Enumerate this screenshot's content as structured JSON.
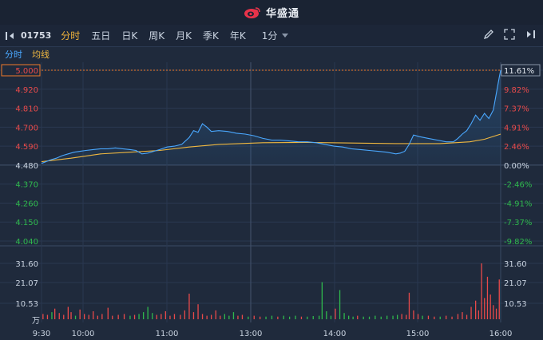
{
  "app": {
    "brand": "华盛通"
  },
  "toolbar": {
    "stock_code": "01753",
    "tabs": [
      "分时",
      "五日",
      "日K",
      "周K",
      "月K",
      "季K",
      "年K"
    ],
    "active_tab": "分时",
    "period": "1分"
  },
  "legend": {
    "price_label": "分时",
    "avg_label": "均线"
  },
  "icons": {
    "brand": "weibo-eye-icon",
    "collapse": "collapse-sidebar-icon",
    "draw": "pencil-icon",
    "fullscreen": "fullscreen-icon",
    "expand": "expand-panel-icon",
    "dropdown": "triangle-down-icon"
  },
  "colors": {
    "up": "#e84a4a",
    "down": "#2fb84d",
    "price_line": "#4aa8ff",
    "avg_line": "#f0b840",
    "current_price": "#f07a2a"
  },
  "chart_data": {
    "type": "line",
    "prev_close": 4.48,
    "current_price": "5.000",
    "current_change": "11.61%",
    "price_ticks": [
      "5.000",
      "4.920",
      "4.810",
      "4.700",
      "4.590",
      "4.480",
      "4.370",
      "4.260",
      "4.150",
      "4.040"
    ],
    "pct_ticks": [
      "11.61%",
      "9.82%",
      "7.37%",
      "4.91%",
      "2.46%",
      "0.00%",
      "-2.46%",
      "-4.91%",
      "-7.37%",
      "-9.82%"
    ],
    "ylim": [
      4.0,
      5.0
    ],
    "volume_ticks": [
      "31.60",
      "21.07",
      "10.53"
    ],
    "volume_unit": "万",
    "volume_max": 31.6,
    "x_ticks": [
      "9:30",
      "10:00",
      "11:00",
      "13:00",
      "14:00",
      "15:00",
      "16:00"
    ],
    "series": [
      {
        "name": "分时",
        "points": [
          [
            0,
            4.49
          ],
          [
            3,
            4.5
          ],
          [
            6,
            4.51
          ],
          [
            10,
            4.52
          ],
          [
            14,
            4.535
          ],
          [
            18,
            4.545
          ],
          [
            22,
            4.555
          ],
          [
            26,
            4.56
          ],
          [
            30,
            4.565
          ],
          [
            35,
            4.57
          ],
          [
            40,
            4.575
          ],
          [
            45,
            4.575
          ],
          [
            50,
            4.58
          ],
          [
            55,
            4.575
          ],
          [
            60,
            4.57
          ],
          [
            64,
            4.565
          ],
          [
            68,
            4.545
          ],
          [
            72,
            4.55
          ],
          [
            76,
            4.56
          ],
          [
            80,
            4.57
          ],
          [
            85,
            4.585
          ],
          [
            90,
            4.59
          ],
          [
            95,
            4.6
          ],
          [
            100,
            4.64
          ],
          [
            103,
            4.68
          ],
          [
            106,
            4.67
          ],
          [
            109,
            4.72
          ],
          [
            112,
            4.7
          ],
          [
            115,
            4.675
          ],
          [
            120,
            4.68
          ],
          [
            126,
            4.675
          ],
          [
            132,
            4.665
          ],
          [
            138,
            4.66
          ],
          [
            144,
            4.65
          ],
          [
            150,
            4.635
          ],
          [
            156,
            4.625
          ],
          [
            162,
            4.625
          ],
          [
            168,
            4.62
          ],
          [
            174,
            4.615
          ],
          [
            180,
            4.615
          ],
          [
            186,
            4.61
          ],
          [
            192,
            4.6
          ],
          [
            198,
            4.59
          ],
          [
            204,
            4.585
          ],
          [
            210,
            4.575
          ],
          [
            216,
            4.57
          ],
          [
            222,
            4.565
          ],
          [
            228,
            4.56
          ],
          [
            234,
            4.555
          ],
          [
            240,
            4.545
          ],
          [
            243,
            4.55
          ],
          [
            246,
            4.56
          ],
          [
            249,
            4.6
          ],
          [
            252,
            4.655
          ],
          [
            256,
            4.645
          ],
          [
            262,
            4.635
          ],
          [
            268,
            4.625
          ],
          [
            274,
            4.615
          ],
          [
            279,
            4.615
          ],
          [
            282,
            4.635
          ],
          [
            285,
            4.66
          ],
          [
            288,
            4.68
          ],
          [
            291,
            4.72
          ],
          [
            294,
            4.77
          ],
          [
            297,
            4.74
          ],
          [
            300,
            4.78
          ],
          [
            303,
            4.75
          ],
          [
            306,
            4.8
          ],
          [
            310,
            4.97
          ],
          [
            311,
            5.0
          ]
        ]
      },
      {
        "name": "均线",
        "points": [
          [
            0,
            4.5
          ],
          [
            20,
            4.52
          ],
          [
            40,
            4.545
          ],
          [
            60,
            4.555
          ],
          [
            80,
            4.565
          ],
          [
            100,
            4.585
          ],
          [
            120,
            4.6
          ],
          [
            150,
            4.61
          ],
          [
            180,
            4.612
          ],
          [
            210,
            4.608
          ],
          [
            240,
            4.605
          ],
          [
            270,
            4.605
          ],
          [
            290,
            4.615
          ],
          [
            300,
            4.63
          ],
          [
            311,
            4.66
          ]
        ]
      }
    ],
    "volume_bars": [
      [
        1,
        3.0,
        "up"
      ],
      [
        4,
        2.5,
        "up"
      ],
      [
        7,
        4.0,
        "down"
      ],
      [
        9,
        6.0,
        "up"
      ],
      [
        12,
        3.5,
        "up"
      ],
      [
        15,
        2.5,
        "up"
      ],
      [
        18,
        7.0,
        "up"
      ],
      [
        20,
        4.0,
        "up"
      ],
      [
        23,
        2.0,
        "down"
      ],
      [
        26,
        5.5,
        "up"
      ],
      [
        29,
        3.0,
        "up"
      ],
      [
        32,
        2.5,
        "up"
      ],
      [
        35,
        4.5,
        "up"
      ],
      [
        38,
        2.0,
        "up"
      ],
      [
        41,
        3.0,
        "up"
      ],
      [
        45,
        6.5,
        "up"
      ],
      [
        48,
        2.0,
        "up"
      ],
      [
        52,
        2.5,
        "up"
      ],
      [
        56,
        3.0,
        "up"
      ],
      [
        60,
        2.0,
        "down"
      ],
      [
        63,
        2.5,
        "up"
      ],
      [
        66,
        3.0,
        "down"
      ],
      [
        69,
        4.0,
        "down"
      ],
      [
        72,
        7.0,
        "down"
      ],
      [
        75,
        3.5,
        "down"
      ],
      [
        78,
        2.5,
        "up"
      ],
      [
        81,
        3.0,
        "up"
      ],
      [
        84,
        4.5,
        "up"
      ],
      [
        87,
        2.0,
        "up"
      ],
      [
        90,
        3.0,
        "up"
      ],
      [
        94,
        2.5,
        "up"
      ],
      [
        97,
        5.0,
        "up"
      ],
      [
        100,
        14.5,
        "up"
      ],
      [
        103,
        4.0,
        "up"
      ],
      [
        106,
        8.5,
        "up"
      ],
      [
        109,
        3.0,
        "up"
      ],
      [
        112,
        2.0,
        "up"
      ],
      [
        115,
        2.5,
        "up"
      ],
      [
        118,
        5.0,
        "up"
      ],
      [
        121,
        2.0,
        "up"
      ],
      [
        124,
        3.0,
        "down"
      ],
      [
        127,
        2.0,
        "down"
      ],
      [
        130,
        4.0,
        "down"
      ],
      [
        133,
        2.0,
        "up"
      ],
      [
        136,
        2.5,
        "up"
      ],
      [
        140,
        1.5,
        "down"
      ],
      [
        144,
        2.0,
        "up"
      ],
      [
        148,
        1.5,
        "up"
      ],
      [
        152,
        1.5,
        "down"
      ],
      [
        156,
        2.0,
        "down"
      ],
      [
        160,
        1.5,
        "up"
      ],
      [
        164,
        2.0,
        "down"
      ],
      [
        168,
        1.5,
        "down"
      ],
      [
        172,
        2.0,
        "down"
      ],
      [
        176,
        1.5,
        "up"
      ],
      [
        180,
        1.5,
        "down"
      ],
      [
        184,
        1.8,
        "down"
      ],
      [
        188,
        2.0,
        "down"
      ],
      [
        190,
        21.0,
        "down"
      ],
      [
        193,
        4.5,
        "down"
      ],
      [
        196,
        2.0,
        "down"
      ],
      [
        199,
        6.0,
        "up"
      ],
      [
        202,
        16.5,
        "down"
      ],
      [
        205,
        3.5,
        "down"
      ],
      [
        208,
        2.0,
        "down"
      ],
      [
        211,
        1.5,
        "down"
      ],
      [
        214,
        2.0,
        "up"
      ],
      [
        218,
        1.5,
        "down"
      ],
      [
        222,
        1.5,
        "down"
      ],
      [
        226,
        2.0,
        "down"
      ],
      [
        230,
        1.5,
        "down"
      ],
      [
        234,
        2.0,
        "down"
      ],
      [
        238,
        2.0,
        "down"
      ],
      [
        241,
        2.5,
        "down"
      ],
      [
        244,
        3.0,
        "up"
      ],
      [
        247,
        2.5,
        "up"
      ],
      [
        249,
        15.0,
        "up"
      ],
      [
        252,
        5.0,
        "up"
      ],
      [
        255,
        3.0,
        "up"
      ],
      [
        258,
        2.0,
        "down"
      ],
      [
        262,
        2.0,
        "up"
      ],
      [
        266,
        1.5,
        "up"
      ],
      [
        270,
        1.5,
        "down"
      ],
      [
        274,
        2.0,
        "up"
      ],
      [
        278,
        1.5,
        "up"
      ],
      [
        282,
        3.0,
        "up"
      ],
      [
        285,
        4.0,
        "up"
      ],
      [
        288,
        2.5,
        "up"
      ],
      [
        291,
        7.0,
        "up"
      ],
      [
        294,
        10.5,
        "up"
      ],
      [
        296,
        5.0,
        "up"
      ],
      [
        298,
        31.6,
        "up"
      ],
      [
        300,
        12.0,
        "up"
      ],
      [
        302,
        24.0,
        "up"
      ],
      [
        304,
        14.0,
        "up"
      ],
      [
        306,
        8.0,
        "up"
      ],
      [
        308,
        6.0,
        "up"
      ],
      [
        310,
        22.5,
        "up"
      ]
    ]
  }
}
